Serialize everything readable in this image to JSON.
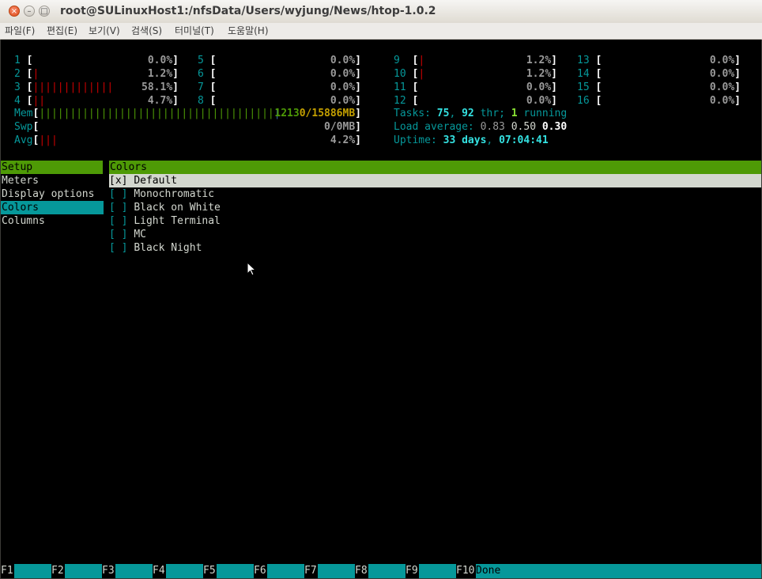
{
  "window": {
    "title": "root@SULinuxHost1:/nfsData/Users/wyjung/News/htop-1.0.2",
    "close_glyph": "×",
    "min_glyph": "–",
    "max_glyph": "□"
  },
  "menubar": {
    "items": [
      "파일(F)",
      "편집(E)",
      "보기(V)",
      "검색(S)",
      "터미널(T)",
      "도움말(H)"
    ]
  },
  "cpus": [
    {
      "label": "1",
      "bar": "",
      "value": "0.0%"
    },
    {
      "label": "2",
      "bar": "|",
      "value": "1.2%"
    },
    {
      "label": "3",
      "bar": "|||||||||||||",
      "value": "58.1%"
    },
    {
      "label": "4",
      "bar": "||",
      "value": "4.7%"
    },
    {
      "label": "5",
      "bar": "",
      "value": "0.0%"
    },
    {
      "label": "6",
      "bar": "",
      "value": "0.0%"
    },
    {
      "label": "7",
      "bar": "",
      "value": "0.0%"
    },
    {
      "label": "8",
      "bar": "",
      "value": "0.0%"
    },
    {
      "label": "9",
      "bar": "|",
      "value": "1.2%"
    },
    {
      "label": "10",
      "bar": "|",
      "value": "1.2%"
    },
    {
      "label": "11",
      "bar": "",
      "value": "0.0%"
    },
    {
      "label": "12",
      "bar": "",
      "value": "0.0%"
    },
    {
      "label": "13",
      "bar": "",
      "value": "0.0%"
    },
    {
      "label": "14",
      "bar": "",
      "value": "0.0%"
    },
    {
      "label": "15",
      "bar": "",
      "value": "0.0%"
    },
    {
      "label": "16",
      "bar": "",
      "value": "0.0%"
    }
  ],
  "mem": {
    "label": "Mem",
    "bar_green": "||||||||||||||||||||||||||||||||||||||",
    "bar_blue": "|",
    "value_used": "1213",
    "value_total": "0/15886",
    "unit": "MB"
  },
  "swp": {
    "label": "Swp",
    "value": "0/0",
    "unit": "MB"
  },
  "avg": {
    "label": "Avg",
    "bar": "|||",
    "value": "4.2%"
  },
  "tasks": {
    "label": "Tasks:",
    "count": "75",
    "sep": ",",
    "threads": "92",
    "thr_label": "thr;",
    "running": "1",
    "running_label": "running"
  },
  "load": {
    "label": "Load average:",
    "l1": "0.83",
    "l5": "0.50",
    "l15": "0.30"
  },
  "uptime": {
    "label": "Uptime:",
    "days": "33",
    "days_label": "days",
    "sep": ",",
    "time": "07:04:41"
  },
  "setup": {
    "header": "Setup",
    "items": [
      "Meters",
      "Display options",
      "Colors",
      "Columns"
    ]
  },
  "colors": {
    "header": "Colors",
    "options": [
      {
        "check": "[x]",
        "label": "Default"
      },
      {
        "check": "[ ]",
        "label": "Monochromatic"
      },
      {
        "check": "[ ]",
        "label": "Black on White"
      },
      {
        "check": "[ ]",
        "label": "Light Terminal"
      },
      {
        "check": "[ ]",
        "label": "MC"
      },
      {
        "check": "[ ]",
        "label": "Black Night"
      }
    ]
  },
  "function_bar": [
    {
      "key": "F1",
      "label": ""
    },
    {
      "key": "F2",
      "label": ""
    },
    {
      "key": "F3",
      "label": ""
    },
    {
      "key": "F4",
      "label": ""
    },
    {
      "key": "F5",
      "label": ""
    },
    {
      "key": "F6",
      "label": ""
    },
    {
      "key": "F7",
      "label": ""
    },
    {
      "key": "F8",
      "label": ""
    },
    {
      "key": "F9",
      "label": ""
    },
    {
      "key": "F10",
      "label": "Done"
    }
  ],
  "colors_palette": {
    "terminal_bg": "#000000",
    "cyan": "#06989a",
    "green": "#4e9a06",
    "red": "#cc0000",
    "yellow": "#c4a000"
  }
}
